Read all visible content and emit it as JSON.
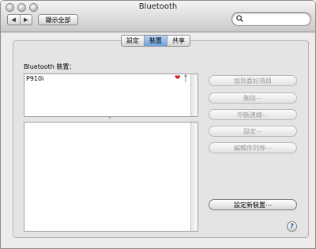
{
  "window": {
    "title": "Bluetooth"
  },
  "toolbar": {
    "back_glyph": "◀",
    "forward_glyph": "▶",
    "show_all_label": "顯示全部",
    "search_icon": "magnifier-icon",
    "search_value": ""
  },
  "tabs": [
    {
      "label": "設定",
      "active": false
    },
    {
      "label": "裝置",
      "active": true
    },
    {
      "label": "共享",
      "active": false
    }
  ],
  "devices": {
    "label": "Bluetooth 裝置：",
    "items": [
      {
        "name": "P910i",
        "favorite_icon": "heart-icon",
        "signal_icon": "antenna-icon"
      }
    ],
    "splitter_glyph": "⌃"
  },
  "actions": {
    "add_favorite": "加到喜好項目",
    "delete": "刪除⋯",
    "disconnect": "中斷連線⋯",
    "configure": "設定⋯",
    "edit_serial_ports": "編輯序列埠⋯",
    "setup_new_device": "設定新裝置⋯"
  },
  "help": {
    "glyph": "?"
  },
  "colors": {
    "active_tab": "#6ea0dd",
    "heart": "#c8231e"
  }
}
